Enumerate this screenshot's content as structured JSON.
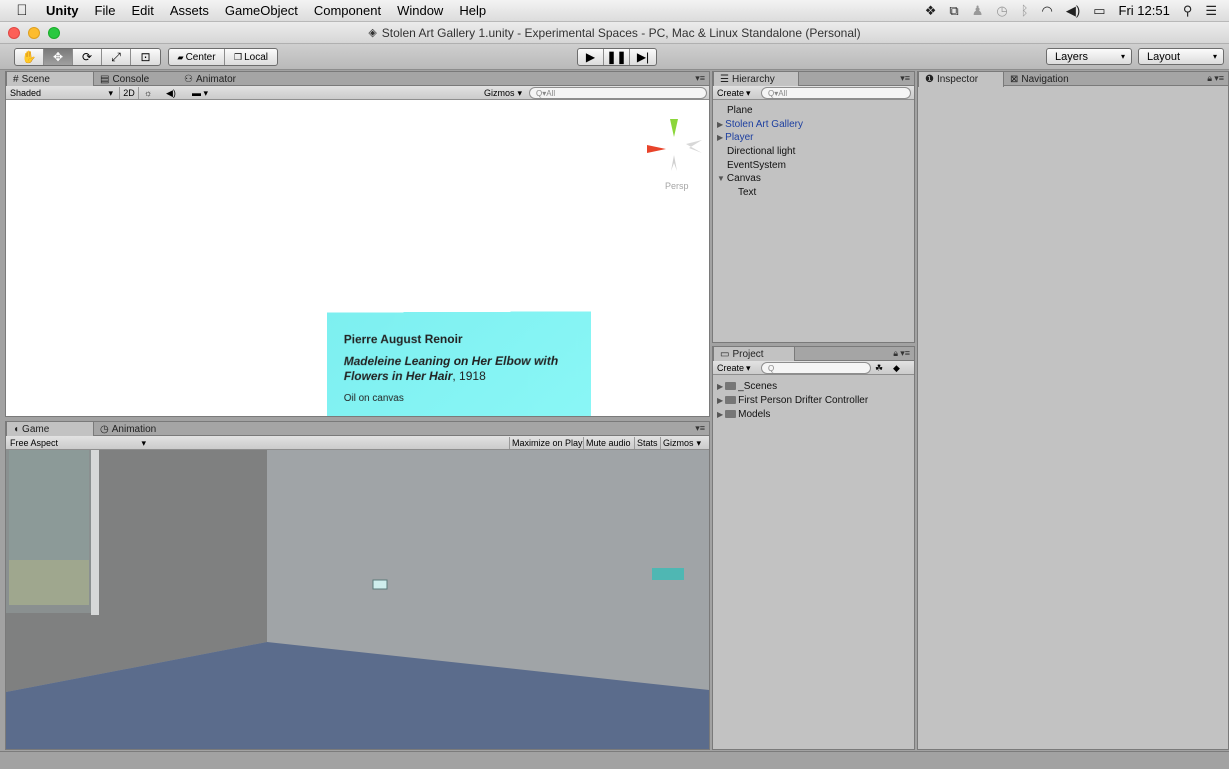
{
  "menubar": {
    "app": "Unity",
    "menus": [
      "File",
      "Edit",
      "Assets",
      "GameObject",
      "Component",
      "Window",
      "Help"
    ],
    "clock": "Fri 12:51"
  },
  "window": {
    "title": "Stolen Art Gallery 1.unity - Experimental Spaces - PC, Mac & Linux Standalone (Personal)"
  },
  "toolbar": {
    "pivot_mode": "Center",
    "pivot_rotation": "Local",
    "layers_label": "Layers",
    "layout_label": "Layout"
  },
  "scene_panel": {
    "tabs": [
      "Scene",
      "Console",
      "Animator"
    ],
    "shading_mode": "Shaded",
    "mode_2d": "2D",
    "gizmos_label": "Gizmos",
    "search_placeholder": "Q▾All",
    "persp_label": "Persp",
    "card": {
      "artist": "Pierre August Renoir",
      "title": "Madeleine Leaning on Her Elbow with Flowers in Her Hair",
      "year": ", 1918",
      "medium": "Oil on canvas"
    }
  },
  "game_panel": {
    "tabs": [
      "Game",
      "Animation"
    ],
    "aspect": "Free Aspect",
    "maximize_on_play": "Maximize on Play",
    "mute_audio": "Mute audio",
    "stats": "Stats",
    "gizmos": "Gizmos"
  },
  "hierarchy": {
    "tab": "Hierarchy",
    "create_label": "Create",
    "search_placeholder": "Q▾All",
    "items": [
      "Plane",
      "Stolen Art Gallery",
      "Player",
      "Directional light",
      "EventSystem",
      "Canvas",
      "Text"
    ]
  },
  "project": {
    "tab": "Project",
    "create_label": "Create",
    "search_placeholder": "Q",
    "folders": [
      "_Scenes",
      "First Person Drifter Controller",
      "Models"
    ]
  },
  "inspector": {
    "tabs": [
      "Inspector",
      "Navigation"
    ]
  },
  "colors": {
    "card_color": "#86f5f5",
    "game_floor": "#5b6c8c",
    "game_wall": "#a0a4a7"
  }
}
